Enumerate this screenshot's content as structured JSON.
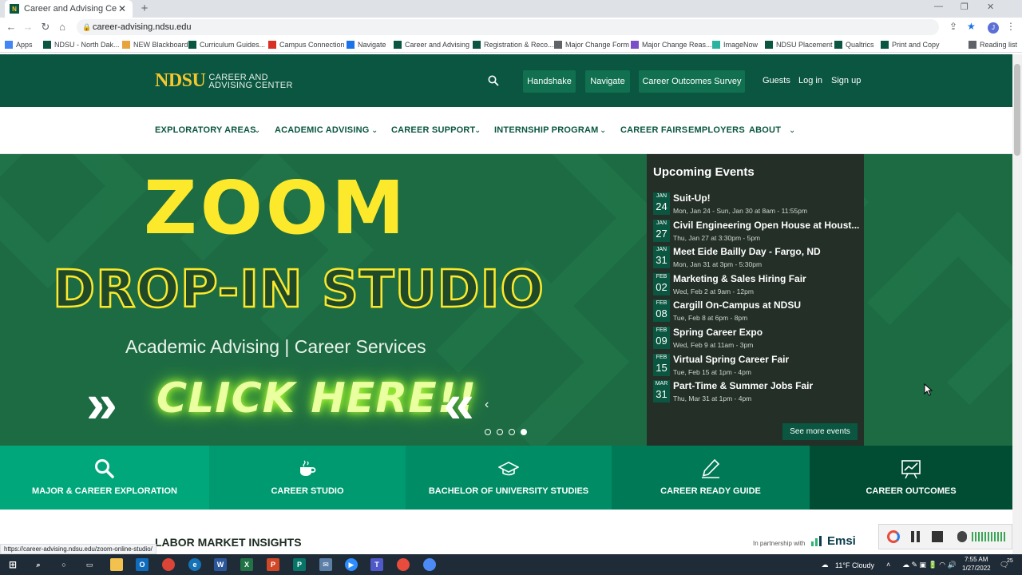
{
  "browser": {
    "tab_title": "Career and Advising Center – No",
    "url": "career-advising.ndsu.edu",
    "bookmarks": [
      {
        "label": "Apps",
        "color": "#4285f4"
      },
      {
        "label": "NDSU - North Dak...",
        "color": "#0a5640"
      },
      {
        "label": "NEW Blackboard",
        "color": "#e8a33d"
      },
      {
        "label": "Curriculum Guides...",
        "color": "#0a5640"
      },
      {
        "label": "Campus Connection",
        "color": "#d93025"
      },
      {
        "label": "Navigate",
        "color": "#1a73e8"
      },
      {
        "label": "Career and Advising",
        "color": "#0a5640"
      },
      {
        "label": "Registration & Reco...",
        "color": "#0a5640"
      },
      {
        "label": "Major Change Form",
        "color": "#5f6368"
      },
      {
        "label": "Major Change Reas...",
        "color": "#7b4fc8"
      },
      {
        "label": "ImageNow",
        "color": "#2bb3a0"
      },
      {
        "label": "NDSU Placement",
        "color": "#0a5640"
      },
      {
        "label": "Qualtrics",
        "color": "#0a5640"
      },
      {
        "label": "Print and Copy",
        "color": "#0a5640"
      },
      {
        "label": "Reading list",
        "color": "#5f6368"
      }
    ],
    "status_url": "https://career-advising.ndsu.edu/zoom-online-studio/"
  },
  "header": {
    "logo_main": "NDSU",
    "logo_sub_line1": "CAREER AND",
    "logo_sub_line2": "ADVISING CENTER",
    "buttons": [
      "Handshake",
      "Navigate",
      "Career Outcomes Survey"
    ],
    "links": [
      "Guests",
      "Log in",
      "Sign up"
    ]
  },
  "nav": {
    "items": [
      "EXPLORATORY AREAS",
      "ACADEMIC ADVISING",
      "CAREER SUPPORT",
      "INTERNSHIP PROGRAM",
      "CAREER FAIRS",
      "EMPLOYERS",
      "ABOUT"
    ]
  },
  "hero": {
    "headline": "ZOOM",
    "subhead": "DROP-IN STUDIO",
    "tagline": "Academic Advising   |   Career Services",
    "cta": "CLICK HERE!!",
    "slide_count": 4,
    "active_slide": 4
  },
  "events": {
    "heading": "Upcoming Events",
    "items": [
      {
        "month": "JAN",
        "day": "24",
        "title": "Suit-Up!",
        "time": "Mon, Jan 24 - Sun, Jan 30 at 8am - 11:55pm"
      },
      {
        "month": "JAN",
        "day": "27",
        "title": "Civil Engineering Open House at Houst...",
        "time": "Thu, Jan 27 at 3:30pm - 5pm"
      },
      {
        "month": "JAN",
        "day": "31",
        "title": "Meet Eide Bailly Day - Fargo, ND",
        "time": "Mon, Jan 31 at 3pm - 5:30pm"
      },
      {
        "month": "FEB",
        "day": "02",
        "title": "Marketing & Sales Hiring Fair",
        "time": "Wed, Feb 2 at 9am - 12pm"
      },
      {
        "month": "FEB",
        "day": "08",
        "title": "Cargill On-Campus at NDSU",
        "time": "Tue, Feb 8 at 6pm - 8pm"
      },
      {
        "month": "FEB",
        "day": "09",
        "title": "Spring Career Expo",
        "time": "Wed, Feb 9 at 11am - 3pm"
      },
      {
        "month": "FEB",
        "day": "15",
        "title": "Virtual Spring Career Fair",
        "time": "Tue, Feb 15 at 1pm - 4pm"
      },
      {
        "month": "MAR",
        "day": "31",
        "title": "Part-Time & Summer Jobs Fair",
        "time": "Thu, Mar 31 at 1pm - 4pm"
      }
    ],
    "see_more": "See more events"
  },
  "quicklinks": [
    {
      "label": "MAJOR & CAREER EXPLORATION",
      "icon": "search-icon",
      "color": "#00a77a"
    },
    {
      "label": "CAREER STUDIO",
      "icon": "coffee-cup-icon",
      "color": "#009a70"
    },
    {
      "label": "BACHELOR OF UNIVERSITY STUDIES",
      "icon": "graduation-cap-icon",
      "color": "#008d65"
    },
    {
      "label": "CAREER READY GUIDE",
      "icon": "pencil-icon",
      "color": "#007a56"
    },
    {
      "label": "CAREER OUTCOMES",
      "icon": "presentation-chart-icon",
      "color": "#004d34"
    }
  ],
  "section": {
    "title": "LABOR MARKET INSIGHTS",
    "partner_text": "In partnership with",
    "partner_name": "Emsi"
  },
  "taskbar": {
    "weather": "11°F  Cloudy",
    "time": "7:55 AM",
    "date": "1/27/2022",
    "notifications": "25"
  }
}
